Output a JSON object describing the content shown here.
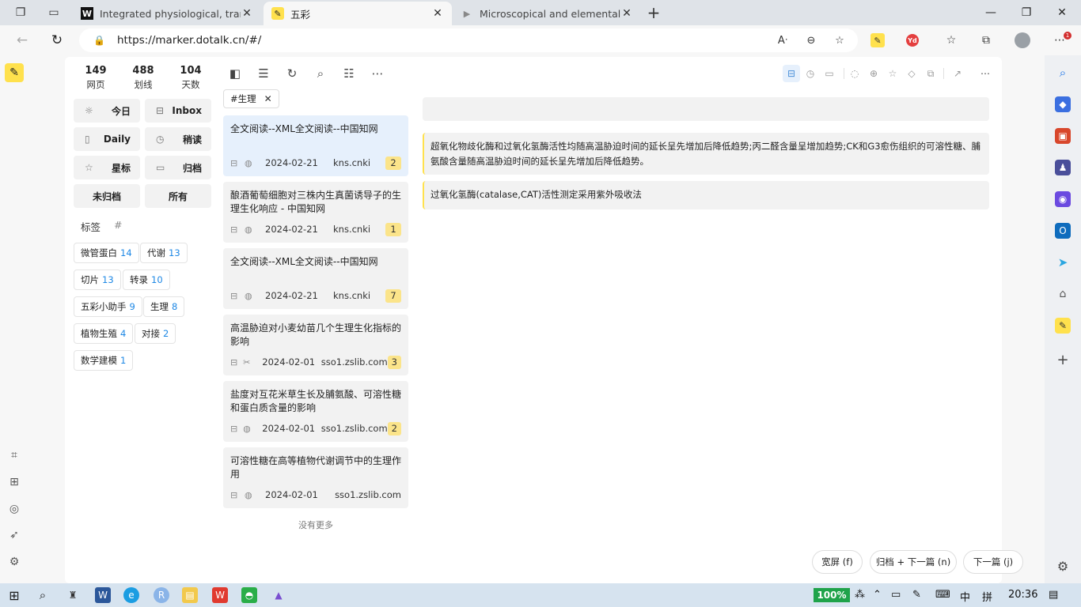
{
  "browser": {
    "tabs": [
      {
        "title": "Integrated physiological, transcri",
        "favicon": "W"
      },
      {
        "title": "五彩",
        "favicon": "pen-icon"
      },
      {
        "title": "Microscopical and elemental FES",
        "favicon": "arrow-icon"
      }
    ],
    "url": "https://marker.dotalk.cn/#/",
    "ext_yd_label": "Yd",
    "notification_count": "1"
  },
  "stats": [
    {
      "value": "149",
      "label": "网页"
    },
    {
      "value": "488",
      "label": "划线"
    },
    {
      "value": "104",
      "label": "天数"
    }
  ],
  "nav": {
    "today": "今日",
    "inbox": "Inbox",
    "daily": "Daily",
    "later": "稍读",
    "starred": "星标",
    "archived": "归档",
    "unarchived": "未归档",
    "all": "所有"
  },
  "tags": {
    "heading": "标签",
    "hash": "#",
    "items": [
      {
        "name": "微管蛋白",
        "count": "14"
      },
      {
        "name": "代谢",
        "count": "13"
      },
      {
        "name": "切片",
        "count": "13"
      },
      {
        "name": "转录",
        "count": "10"
      },
      {
        "name": "五彩小助手",
        "count": "9"
      },
      {
        "name": "生理",
        "count": "8"
      },
      {
        "name": "植物生殖",
        "count": "4"
      },
      {
        "name": "对接",
        "count": "2"
      },
      {
        "name": "数学建模",
        "count": "1"
      }
    ]
  },
  "filter_chip": "#生理",
  "articles": [
    {
      "title": "全文阅读--XML全文阅读--中国知网",
      "date": "2024-02-21",
      "source": "kns.cnki",
      "count": "2"
    },
    {
      "title": "酿酒葡萄细胞对三株内生真菌诱导子的生理生化响应 - 中国知网",
      "date": "2024-02-21",
      "source": "kns.cnki",
      "count": "1"
    },
    {
      "title": "全文阅读--XML全文阅读--中国知网",
      "date": "2024-02-21",
      "source": "kns.cnki",
      "count": "7"
    },
    {
      "title": "高温胁迫对小麦幼苗几个生理生化指标的影响",
      "date": "2024-02-01",
      "source": "sso1.zslib.com",
      "count": "3"
    },
    {
      "title": "盐度对互花米草生长及脯氨酸、可溶性糖和蛋白质含量的影响",
      "date": "2024-02-01",
      "source": "sso1.zslib.com",
      "count": "2"
    },
    {
      "title": "可溶性糖在高等植物代谢调节中的生理作用",
      "date": "2024-02-01",
      "source": "sso1.zslib.com",
      "count": ""
    }
  ],
  "no_more": "没有更多",
  "highlights": [
    "超氧化物歧化酶和过氧化氢酶活性均随高温胁迫时间的延长呈先增加后降低趋势;丙二醛含量呈增加趋势;CK和G3愈伤组织的可溶性糖、脯氨酸含量随高温胁迫时间的延长呈先增加后降低趋势。",
    "过氧化氢酶(catalase,CAT)活性测定采用紫外吸收法"
  ],
  "footer": {
    "fullscreen": "宽屏 (f)",
    "archive_next": "归档 + 下一篇 (n)",
    "next": "下一篇 (j)"
  },
  "taskbar": {
    "battery": "100%",
    "ime": "中",
    "layout": "拼",
    "time": "20:36"
  },
  "colors": {
    "accent_yellow": "#ffe14d",
    "badge_yellow": "#fbe48a",
    "tag_count_blue": "#1e88e5",
    "selected_card": "#e6f0fc"
  }
}
